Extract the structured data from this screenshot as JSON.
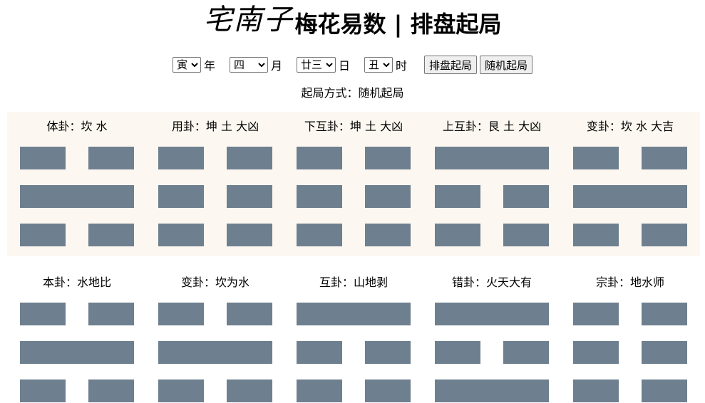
{
  "header": {
    "logo": "宅南子",
    "title": "梅花易数 | 排盘起局"
  },
  "controls": {
    "year": {
      "selected": "寅",
      "unit": "年"
    },
    "month": {
      "selected": "四",
      "unit": "月"
    },
    "day": {
      "selected": "廿三",
      "unit": "日"
    },
    "hour": {
      "selected": "丑",
      "unit": "时"
    },
    "paipan_label": "排盘起局",
    "random_label": "随机起局"
  },
  "method": "起局方式：随机起局",
  "colors": {
    "yao": "#6e7f8f",
    "panel_bg": "#fcf8f1"
  },
  "panel1": [
    {
      "title": "体卦：坎 水",
      "lines": [
        0,
        1,
        0
      ]
    },
    {
      "title": "用卦：坤 土 大凶",
      "lines": [
        0,
        0,
        0
      ]
    },
    {
      "title": "下互卦：坤 土 大凶",
      "lines": [
        0,
        0,
        0
      ]
    },
    {
      "title": "上互卦：艮 土 大凶",
      "lines": [
        1,
        0,
        0
      ]
    },
    {
      "title": "变卦：坎 水 大吉",
      "lines": [
        0,
        1,
        0
      ]
    }
  ],
  "panel2": [
    {
      "title": "本卦：水地比",
      "lines": [
        0,
        1,
        0
      ]
    },
    {
      "title": "变卦：坎为水",
      "lines": [
        0,
        1,
        0
      ]
    },
    {
      "title": "互卦：山地剥",
      "lines": [
        1,
        0,
        0
      ]
    },
    {
      "title": "错卦：火天大有",
      "lines": [
        1,
        0,
        1
      ]
    },
    {
      "title": "宗卦：地水师",
      "lines": [
        0,
        0,
        0
      ]
    }
  ]
}
